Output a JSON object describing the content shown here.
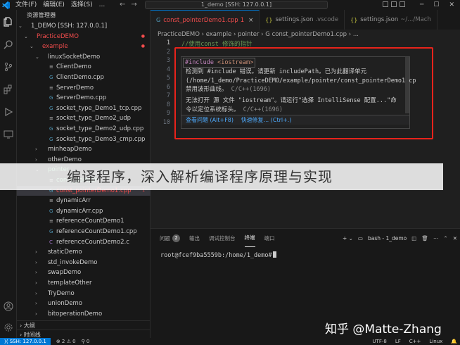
{
  "titlebar": {
    "menu": [
      "文件(F)",
      "编辑(E)",
      "选择(S)",
      "..."
    ],
    "nav_back": "←",
    "nav_forward": "→",
    "search": "1_demo [SSH: 127.0.0.1]"
  },
  "sidebar": {
    "title": "资源管理器",
    "items": [
      {
        "label": "1_DEMO [SSH: 127.0.0.1]",
        "twisty": "⌄",
        "icon": ""
      },
      {
        "label": "PracticeDEMO",
        "twisty": "⌄",
        "icon": "",
        "status": "●"
      },
      {
        "label": "example",
        "twisty": "⌄",
        "icon": "",
        "status": "●"
      },
      {
        "label": "linuxSocketDemo",
        "twisty": "⌄",
        "icon": ""
      },
      {
        "label": "ClientDemo",
        "twisty": "",
        "icon": "≡"
      },
      {
        "label": "ClientDemo.cpp",
        "twisty": "",
        "icon": "G"
      },
      {
        "label": "ServerDemo",
        "twisty": "",
        "icon": "≡"
      },
      {
        "label": "ServerDemo.cpp",
        "twisty": "",
        "icon": "G"
      },
      {
        "label": "socket_type_Demo1_tcp.cpp",
        "twisty": "",
        "icon": "G"
      },
      {
        "label": "socket_type_Demo2_udp",
        "twisty": "",
        "icon": "≡"
      },
      {
        "label": "socket_type_Demo2_udp.cpp",
        "twisty": "",
        "icon": "G"
      },
      {
        "label": "socket_type_Demo3_cmp.cpp",
        "twisty": "",
        "icon": "G"
      },
      {
        "label": "minheapDemo",
        "twisty": "›",
        "icon": ""
      },
      {
        "label": "otherDemo",
        "twisty": "›",
        "icon": ""
      },
      {
        "label": "pointer",
        "twisty": "⌄",
        "icon": ""
      },
      {
        "label": "const_pointer",
        "twisty": "",
        "icon": "≡"
      },
      {
        "label": "const_pointerDemo1.cpp",
        "twisty": "",
        "icon": "G",
        "status": "1"
      },
      {
        "label": "dynamicArr",
        "twisty": "",
        "icon": "≡"
      },
      {
        "label": "dynamicArr.cpp",
        "twisty": "",
        "icon": "G"
      },
      {
        "label": "referenceCountDemo1",
        "twisty": "",
        "icon": "≡"
      },
      {
        "label": "referenceCountDemo1.cpp",
        "twisty": "",
        "icon": "G"
      },
      {
        "label": "referenceCountDemo2.c",
        "twisty": "",
        "icon": "C"
      },
      {
        "label": "staticDemo",
        "twisty": "›",
        "icon": ""
      },
      {
        "label": "std_invokeDemo",
        "twisty": "›",
        "icon": ""
      },
      {
        "label": "swapDemo",
        "twisty": "›",
        "icon": ""
      },
      {
        "label": "templateOther",
        "twisty": "›",
        "icon": ""
      },
      {
        "label": "TryDemo",
        "twisty": "›",
        "icon": ""
      },
      {
        "label": "unionDemo",
        "twisty": "›",
        "icon": ""
      },
      {
        "label": "bitoperationDemo",
        "twisty": "›",
        "icon": ""
      }
    ],
    "outline": "大纲",
    "timeline": "时间线"
  },
  "tabs": [
    {
      "label": "const_pointerDemo1.cpp",
      "sub": "1",
      "icon": "G",
      "close": "×"
    },
    {
      "label": "settings.json",
      "sub": ".vscode",
      "icon": "{}"
    },
    {
      "label": "settings.json",
      "sub": "~/.../Mach",
      "icon": "{}"
    }
  ],
  "breadcrumb": "PracticeDEMO › example › pointer › G const_pointerDemo1.cpp › ...",
  "code": {
    "lines": [
      {
        "n": "1",
        "text": "//使用const 修饰的指针"
      },
      {
        "n": "2",
        "text": ""
      },
      {
        "n": "3",
        "text": ""
      },
      {
        "n": "4",
        "text": ""
      },
      {
        "n": "5",
        "text": ""
      },
      {
        "n": "6",
        "text": ""
      },
      {
        "n": "7",
        "text": ""
      },
      {
        "n": "8",
        "text": ""
      },
      {
        "n": "9",
        "text": ""
      },
      {
        "n": "10",
        "text": ""
      }
    ]
  },
  "hover": {
    "include_kw": "#include",
    "include_arg": "<iostream>",
    "line1": "检测到 #include 错误。请更新 includePath。已为此翻译单元",
    "line2": "(/home/1_demo/PracticeDEMO/example/pointer/const_pointerDemo1.cp",
    "line3": "禁用波形曲线。",
    "source1": "C/C++(1696)",
    "line4": "无法打开 源 文件 \"iostream\"。请运行\"选择 IntelliSense 配置...\"命",
    "line5": "令以定位系统标头。",
    "source2": "C/C++(1696)",
    "action_view": "查看问题 (Alt+F8)",
    "action_fix": "快速修复... (Ctrl+.)"
  },
  "overlay_text": "编译程序，深入解析编译程序原理与实现",
  "panel": {
    "tabs": [
      {
        "label": "问题",
        "badge": "2"
      },
      {
        "label": "输出"
      },
      {
        "label": "调试控制台"
      },
      {
        "label": "终端"
      },
      {
        "label": "端口"
      }
    ],
    "terminal_name": "bash - 1_demo",
    "prompt": "root@fcef9ba5559b:/home/1_demo#"
  },
  "watermark": "知乎 @Matte-Zhang",
  "statusbar": {
    "remote": "SSH: 127.0.0.1",
    "problems": "⊗ 2  ⚠ 0",
    "ports": "⚲ 0",
    "encoding": "UTF-8",
    "eol": "LF",
    "language": "C++",
    "os": "Linux"
  },
  "colors": {
    "accent": "#0078d4",
    "error": "#f14c4c",
    "highlight_box": "#e8231b"
  }
}
